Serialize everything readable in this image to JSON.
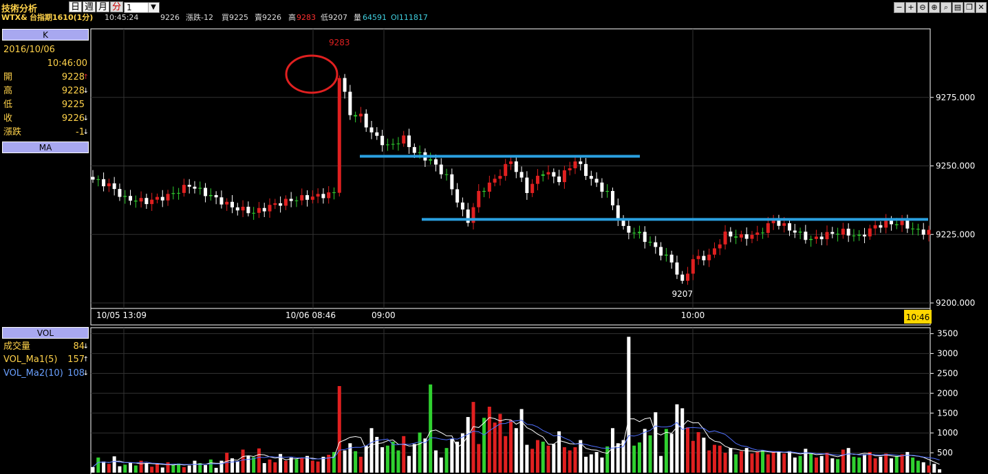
{
  "window": {
    "title": "技術分析",
    "period_tabs": [
      {
        "label": "日",
        "active": false
      },
      {
        "label": "週",
        "active": false
      },
      {
        "label": "月",
        "active": false
      },
      {
        "label": "分",
        "active": true
      }
    ],
    "interval_value": "1",
    "buttons": [
      "minus-icon",
      "plus-icon",
      "zoom-out-icon",
      "zoom-in-icon",
      "zoom-icon",
      "print-icon",
      "restore-icon",
      "close-icon"
    ]
  },
  "info": {
    "symbol": "WTX&",
    "name": "台指期1610(1分)",
    "time": "10:45:24",
    "last": "9226",
    "change": "漲跌-12",
    "bid": "買9225",
    "ask": "賣9226",
    "high_label": "高",
    "high_value": "9283",
    "low": "低9207",
    "volume_label": "量",
    "volume_value": "64591",
    "oi": "OI111817"
  },
  "k_panel": {
    "header": "K",
    "date": "2016/10/06",
    "time": "10:46:00",
    "rows": [
      {
        "label": "開",
        "value": "9228",
        "arrow": "↑",
        "arrow_color": "#e03030"
      },
      {
        "label": "高",
        "value": "9228",
        "arrow": "↓",
        "arrow_color": "#ffffff"
      },
      {
        "label": "低",
        "value": "9225",
        "arrow": "",
        "arrow_color": "#ffffff"
      },
      {
        "label": "收",
        "value": "9226",
        "arrow": "↓",
        "arrow_color": "#ffffff"
      },
      {
        "label": "漲跌",
        "value": "-1",
        "arrow": "↓",
        "arrow_color": "#ffffff"
      }
    ],
    "ma_header": "MA"
  },
  "vol_panel": {
    "header": "VOL",
    "rows": [
      {
        "label": "成交量",
        "value": "84",
        "arrow": "↓",
        "color": "#ffd24a"
      },
      {
        "label": "VOL_Ma1(5)",
        "value": "157",
        "arrow": "↑",
        "color": "#ffd24a"
      },
      {
        "label": "VOL_Ma2(10)",
        "value": "108",
        "arrow": "↓",
        "color": "#6aa0ff"
      }
    ]
  },
  "colors": {
    "up": "#e02020",
    "down": "#ffffff",
    "flat": "#30d030",
    "grid": "#333333",
    "overlay_line": "#2aa0e0",
    "circle": "#e02020",
    "ma1": "#ffffff",
    "ma2": "#5070ff",
    "time_highlight": "#ffd700"
  },
  "chart_data": [
    {
      "type": "candlestick",
      "y_range": [
        9198,
        9300
      ],
      "y_ticks": [
        "9200.000",
        "9225.000",
        "9250.000",
        "9275.000"
      ],
      "x_labels": [
        "10/05 13:09",
        "10/06 08:46",
        "09:00",
        "10:00",
        "10:46"
      ],
      "annotations": {
        "high": "9283",
        "low": "9207"
      },
      "overlay_lines": [
        9253.5,
        9230.5
      ],
      "keypoints": [
        [
          0,
          9245
        ],
        [
          3,
          9243
        ],
        [
          6,
          9238
        ],
        [
          10,
          9237
        ],
        [
          14,
          9239
        ],
        [
          18,
          9243
        ],
        [
          22,
          9239
        ],
        [
          26,
          9235
        ],
        [
          30,
          9233
        ],
        [
          34,
          9236
        ],
        [
          38,
          9238
        ],
        [
          42,
          9239
        ],
        [
          45,
          9240
        ],
        [
          46,
          9283
        ],
        [
          48,
          9269
        ],
        [
          50,
          9268
        ],
        [
          52,
          9262
        ],
        [
          55,
          9257
        ],
        [
          58,
          9260
        ],
        [
          60,
          9255
        ],
        [
          63,
          9252
        ],
        [
          66,
          9246
        ],
        [
          69,
          9233
        ],
        [
          70,
          9230
        ],
        [
          72,
          9240
        ],
        [
          75,
          9245
        ],
        [
          78,
          9252
        ],
        [
          81,
          9241
        ],
        [
          84,
          9248
        ],
        [
          87,
          9245
        ],
        [
          90,
          9252
        ],
        [
          93,
          9245
        ],
        [
          96,
          9240
        ],
        [
          99,
          9227
        ],
        [
          102,
          9225
        ],
        [
          105,
          9220
        ],
        [
          108,
          9215
        ],
        [
          110,
          9207
        ],
        [
          112,
          9216
        ],
        [
          115,
          9217
        ],
        [
          118,
          9225
        ],
        [
          121,
          9224
        ],
        [
          124,
          9225
        ],
        [
          127,
          9230
        ],
        [
          130,
          9227
        ],
        [
          134,
          9223
        ],
        [
          137,
          9225
        ],
        [
          140,
          9226
        ],
        [
          143,
          9224
        ],
        [
          146,
          9228
        ],
        [
          148,
          9229
        ],
        [
          151,
          9229
        ],
        [
          154,
          9226
        ],
        [
          156,
          9226
        ]
      ]
    },
    {
      "type": "bar",
      "series_names": [
        "成交量",
        "VOL_Ma1(5)",
        "VOL_Ma2(10)"
      ],
      "y_range": [
        0,
        3650
      ],
      "y_ticks": [
        "500",
        "1000",
        "1500",
        "2000",
        "2500",
        "3000",
        "3500"
      ],
      "values": [
        140,
        380,
        280,
        220,
        410,
        160,
        200,
        260,
        180,
        300,
        240,
        150,
        220,
        130,
        260,
        200,
        230,
        140,
        180,
        300,
        240,
        190,
        330,
        120,
        300,
        500,
        360,
        280,
        580,
        420,
        390,
        610,
        240,
        330,
        260,
        470,
        300,
        380,
        340,
        380,
        420,
        300,
        280,
        400,
        450,
        520,
        2180,
        560,
        740,
        540,
        400,
        680,
        1120,
        900,
        640,
        680,
        780,
        560,
        920,
        420,
        720,
        1010,
        860,
        2220,
        560,
        380,
        620,
        850,
        780,
        990,
        1400,
        1780,
        720,
        1380,
        1660,
        1260,
        1480,
        920,
        1320,
        1120,
        1600,
        700,
        600,
        820,
        780,
        680,
        720,
        1040,
        640,
        560,
        640,
        820,
        400,
        460,
        520,
        380,
        660,
        1120,
        740,
        820,
        3420,
        680,
        760,
        1100,
        940,
        1520,
        420,
        1100,
        980,
        1720,
        1620,
        1140,
        800,
        1020,
        880,
        560,
        700,
        680,
        500,
        620,
        460,
        540,
        620,
        480,
        520,
        560,
        460,
        540,
        520,
        480,
        540,
        380,
        420,
        600,
        480,
        380,
        420,
        500,
        360,
        340,
        580,
        620,
        400,
        380,
        460,
        520,
        360,
        400,
        480,
        360,
        420,
        460,
        520,
        380,
        300,
        260,
        180,
        220,
        84
      ]
    }
  ]
}
